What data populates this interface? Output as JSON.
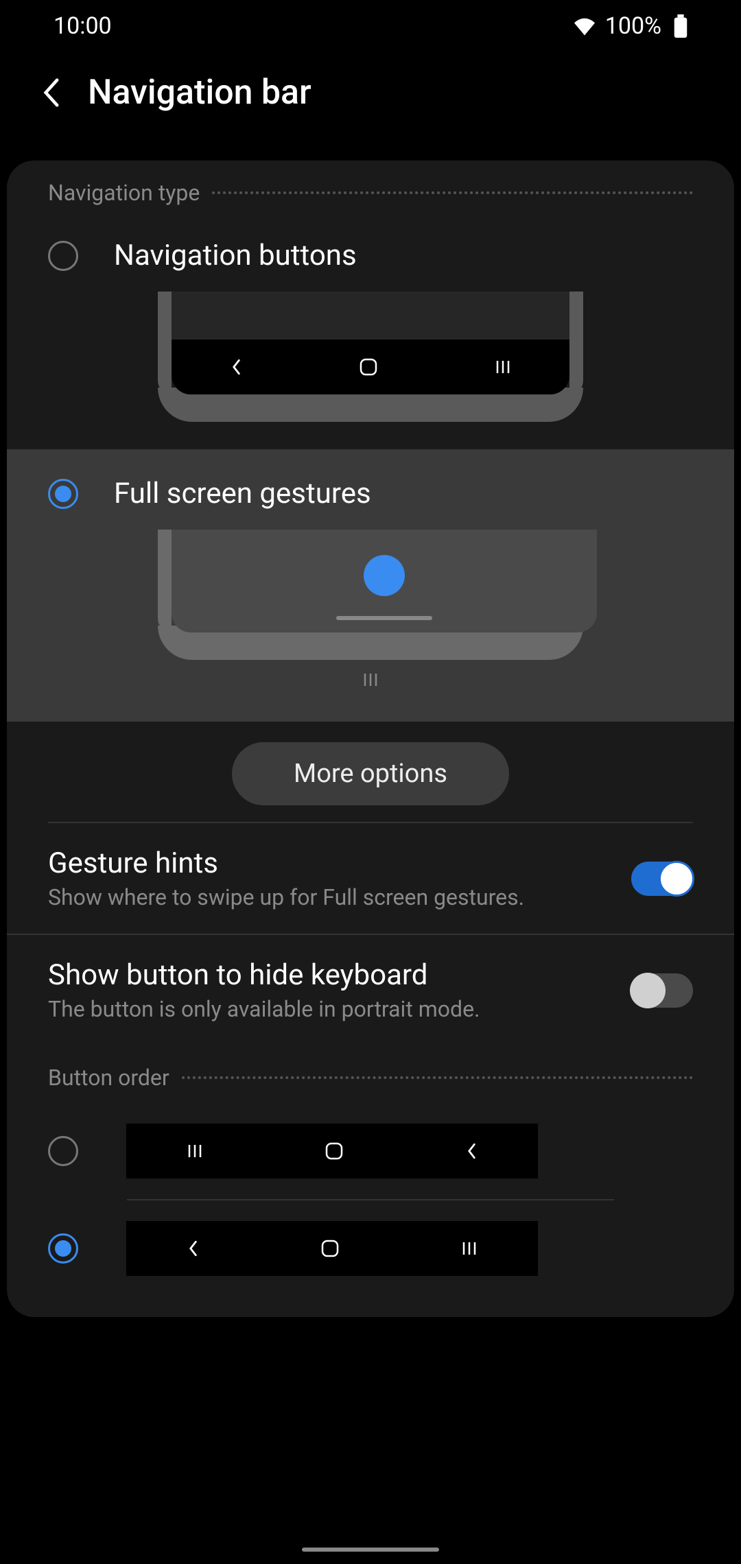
{
  "status": {
    "time": "10:00",
    "battery_text": "100%"
  },
  "header": {
    "title": "Navigation bar"
  },
  "nav_type": {
    "section_label": "Navigation type",
    "buttons_label": "Navigation buttons",
    "gestures_label": "Full screen gestures",
    "selected": "gestures"
  },
  "more_options_label": "More options",
  "gesture_hints": {
    "title": "Gesture hints",
    "subtitle": "Show where to swipe up for Full screen gestures.",
    "enabled": true
  },
  "hide_keyboard": {
    "title": "Show button to hide keyboard",
    "subtitle": "The button is only available in portrait mode.",
    "enabled": false
  },
  "button_order": {
    "section_label": "Button order",
    "selected": 1,
    "options": [
      {
        "order": [
          "recents",
          "home",
          "back"
        ]
      },
      {
        "order": [
          "back",
          "home",
          "recents"
        ]
      }
    ]
  },
  "icons": {
    "back": "back-icon",
    "home": "home-icon",
    "recents": "recents-icon"
  }
}
